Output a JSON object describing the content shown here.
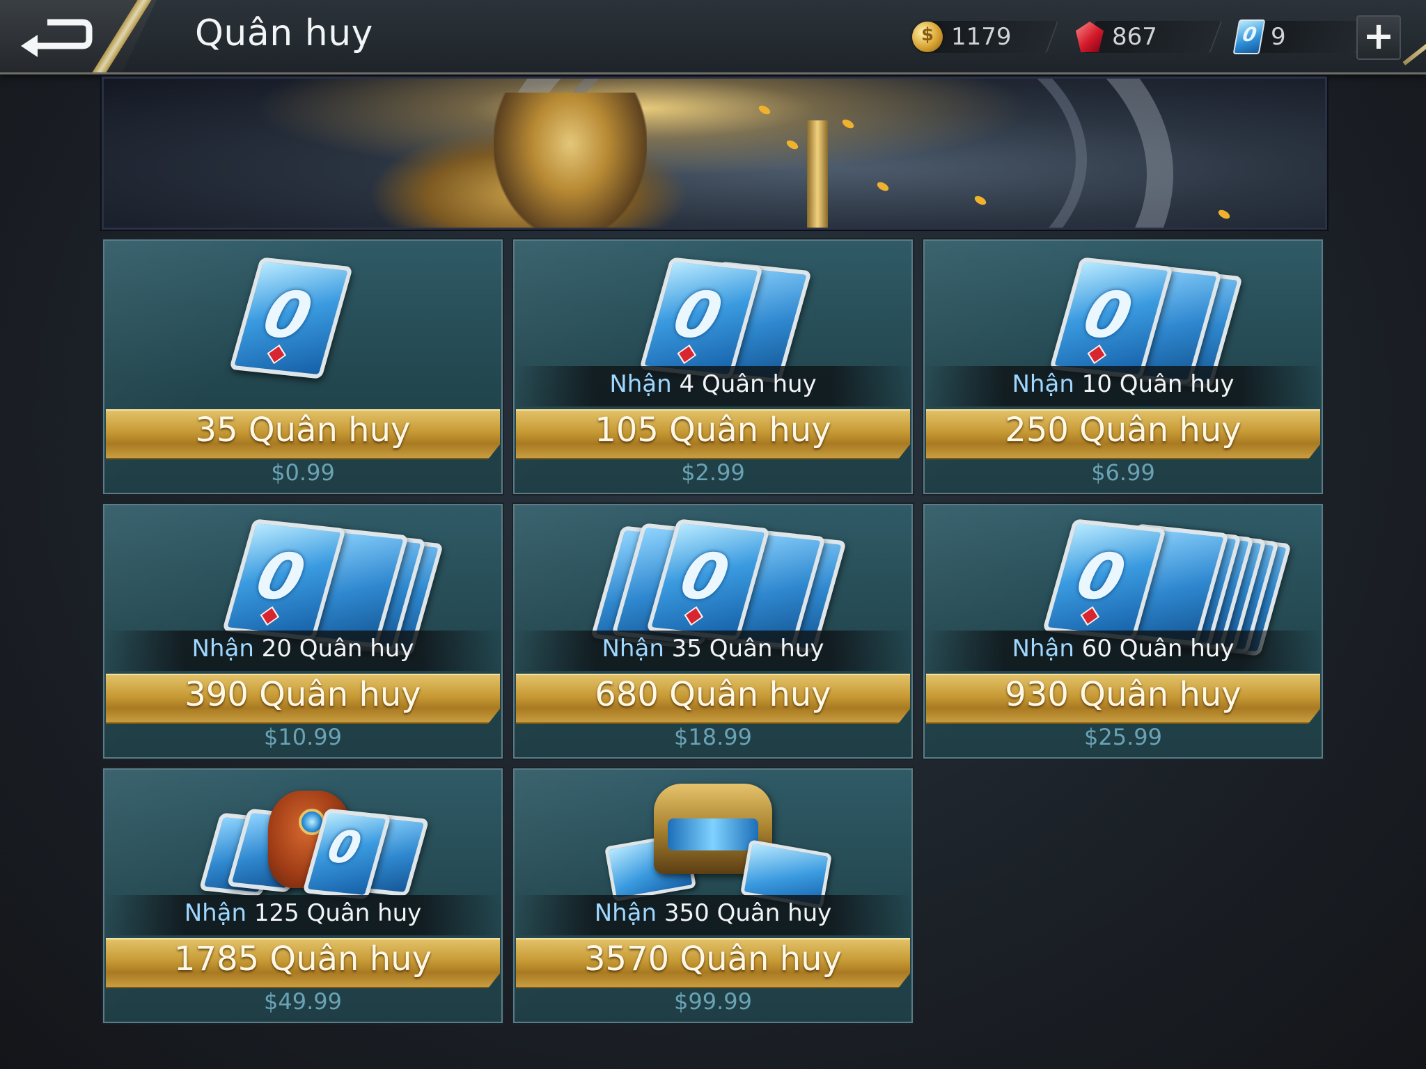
{
  "header": {
    "title": "Quân huy",
    "back_icon": "back-arrow-icon"
  },
  "currencies": [
    {
      "icon": "gold-coin-icon",
      "value": "1179"
    },
    {
      "icon": "ruby-gem-icon",
      "value": "867"
    },
    {
      "icon": "voucher-card-icon",
      "value": "9"
    }
  ],
  "plus_label": "+",
  "packs": [
    {
      "amount": "35 Quân huy",
      "bonus_prefix": "",
      "bonus_rest": "",
      "price": "$0.99"
    },
    {
      "amount": "105 Quân huy",
      "bonus_prefix": "Nhận",
      "bonus_rest": " 4 Quân huy",
      "price": "$2.99"
    },
    {
      "amount": "250 Quân huy",
      "bonus_prefix": "Nhận",
      "bonus_rest": " 10 Quân huy",
      "price": "$6.99"
    },
    {
      "amount": "390 Quân huy",
      "bonus_prefix": "Nhận",
      "bonus_rest": " 20 Quân huy",
      "price": "$10.99"
    },
    {
      "amount": "680 Quân huy",
      "bonus_prefix": "Nhận",
      "bonus_rest": " 35 Quân huy",
      "price": "$18.99"
    },
    {
      "amount": "930 Quân huy",
      "bonus_prefix": "Nhận",
      "bonus_rest": " 60 Quân huy",
      "price": "$25.99"
    },
    {
      "amount": "1785 Quân huy",
      "bonus_prefix": "Nhận",
      "bonus_rest": " 125 Quân huy",
      "price": "$49.99"
    },
    {
      "amount": "3570 Quân huy",
      "bonus_prefix": "Nhận",
      "bonus_rest": " 350 Quân huy",
      "price": "$99.99"
    }
  ],
  "colors": {
    "gold": "#c79a35",
    "price_text": "#6aa3b5",
    "bonus_highlight": "#9fd7ff",
    "tile_bg": "#2f5a66"
  }
}
